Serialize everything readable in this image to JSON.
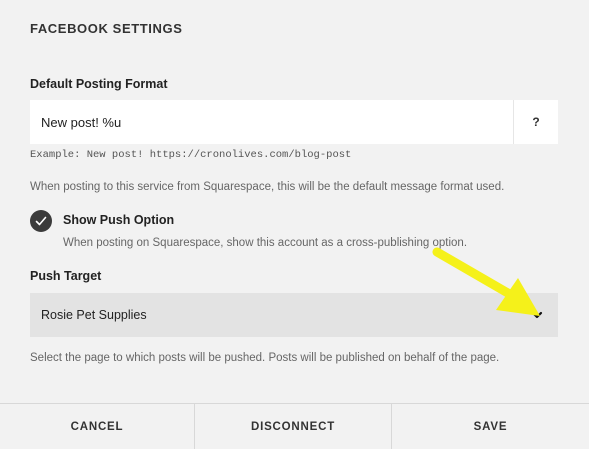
{
  "panel": {
    "title": "FACEBOOK SETTINGS"
  },
  "posting_format": {
    "label": "Default Posting Format",
    "value": "New post! %u",
    "help_label": "?",
    "example": "Example: New post! https://cronolives.com/blog-post",
    "description": "When posting to this service from Squarespace, this will be the default message format used."
  },
  "push_option": {
    "checked": true,
    "label": "Show Push Option",
    "description": "When posting on Squarespace, show this account as a cross-publishing option."
  },
  "push_target": {
    "label": "Push Target",
    "selected": "Rosie Pet Supplies",
    "description": "Select the page to which posts will be pushed. Posts will be published on behalf of the page."
  },
  "annotation": {
    "arrow_color": "#f5f11a",
    "icon": "pointer-arrow-icon"
  },
  "footer": {
    "cancel": "CANCEL",
    "disconnect": "DISCONNECT",
    "save": "SAVE"
  },
  "colors": {
    "background": "#f2f2f2",
    "select_bg": "#e3e3e3",
    "check_bg": "#3b3b3b"
  }
}
